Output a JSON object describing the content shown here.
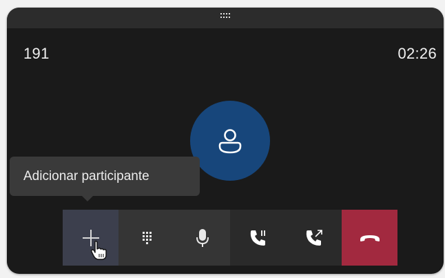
{
  "window": {
    "caller_number": "191",
    "timer": "02:26"
  },
  "tooltip": {
    "text": "Adicionar participante"
  },
  "controls": {
    "add_participant": {
      "icon": "plus-icon"
    },
    "dialpad": {
      "icon": "dialpad-icon"
    },
    "microphone": {
      "icon": "microphone-icon"
    },
    "hold": {
      "icon": "phone-hold-icon"
    },
    "transfer": {
      "icon": "phone-transfer-icon"
    },
    "hang_up": {
      "icon": "hang-up-icon"
    }
  },
  "colors": {
    "background": "#1a1a1a",
    "titlebar": "#2c2c2c",
    "avatar": "#17467b",
    "hang_up": "#a2293f",
    "add_active": "#3c3f4d",
    "tooltip": "#3a3a3a"
  }
}
